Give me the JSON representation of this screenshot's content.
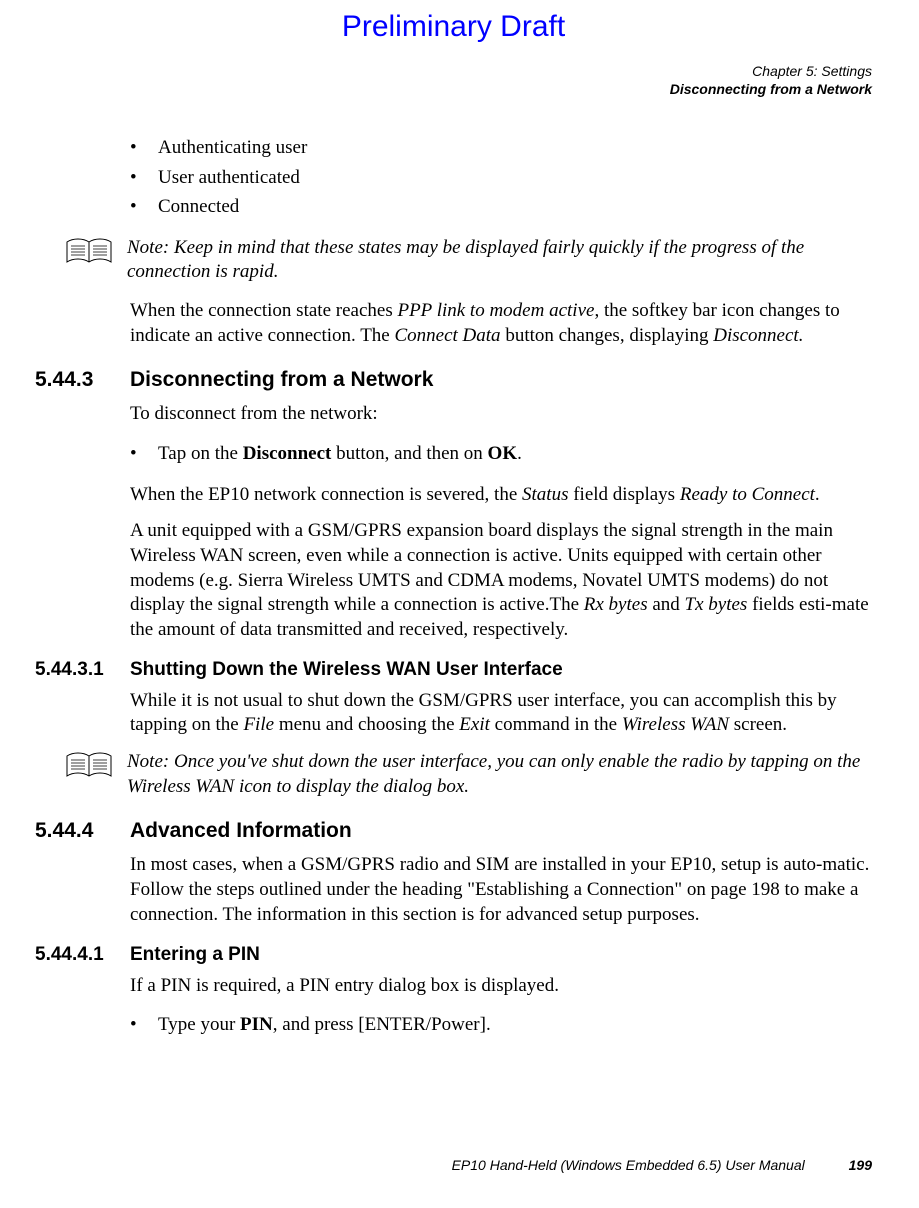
{
  "header": {
    "prelim": "Preliminary Draft",
    "chapter": "Chapter 5:  Settings",
    "section": "Disconnecting from a Network"
  },
  "bullets1": {
    "i0": "Authenticating user",
    "i1": "User authenticated",
    "i2": "Connected"
  },
  "note1": {
    "label": "Note:",
    "text": " Keep in mind that these states may be displayed fairly quickly if the progress of the connection is rapid."
  },
  "para1": {
    "pre": "When the connection state reaches ",
    "it1": "PPP link to modem active",
    "mid": ", the softkey bar icon changes to indicate an active connection. The ",
    "it2": "Connect Data",
    "post": " button changes, displaying ",
    "it3": "Disconnect."
  },
  "sec5443": {
    "num": "5.44.3",
    "title": "Disconnecting from a Network",
    "p1": "To disconnect from the network:",
    "b1_pre": "Tap on the ",
    "b1_bold1": "Disconnect",
    "b1_mid": " button, and then on ",
    "b1_bold2": "OK",
    "b1_post": ".",
    "p2_pre": "When the EP10 network connection is severed, the ",
    "p2_it1": "Status",
    "p2_mid": " field displays ",
    "p2_it2": "Ready to Connect",
    "p2_post": ".",
    "p3_pre": "A unit equipped with a GSM/GPRS expansion board displays the signal strength in the main Wireless WAN screen, even while a connection is active. Units equipped with certain other modems (e.g. Sierra Wireless UMTS and CDMA modems, Novatel UMTS modems) do not display the signal strength while a connection is active.The ",
    "p3_it1": "Rx bytes",
    "p3_mid": " and ",
    "p3_it2": "Tx bytes",
    "p3_post": " fields esti-mate the amount of data transmitted and received, respectively."
  },
  "sec54431": {
    "num": "5.44.3.1",
    "title": "Shutting Down the Wireless WAN User Interface",
    "p1_pre": "While it is not usual to shut down the GSM/GPRS user interface, you can accomplish this by tapping on the ",
    "p1_it1": "File",
    "p1_mid": " menu and choosing the ",
    "p1_it2": "Exit",
    "p1_mid2": " command in the ",
    "p1_it3": "Wireless WAN",
    "p1_post": " screen."
  },
  "note2": {
    "label": "Note:",
    "text": " Once you've shut down the user interface, you can only enable the radio by tapping on the Wireless WAN icon to display the dialog box."
  },
  "sec5444": {
    "num": "5.44.4",
    "title": "Advanced Information",
    "p1": "In most cases, when a GSM/GPRS radio and SIM are installed in your EP10, setup is auto-matic. Follow the steps outlined under the heading \"Establishing a Connection\" on page 198 to make a connection. The information in this section is for advanced setup purposes."
  },
  "sec54441": {
    "num": "5.44.4.1",
    "title": "Entering a PIN",
    "p1": "If a PIN is required, a PIN entry dialog box is displayed.",
    "b1_pre": "Type your ",
    "b1_bold": "PIN",
    "b1_post": ", and press [ENTER/Power]."
  },
  "footer": {
    "manual": "EP10 Hand-Held (Windows Embedded 6.5) User Manual",
    "page": "199"
  }
}
